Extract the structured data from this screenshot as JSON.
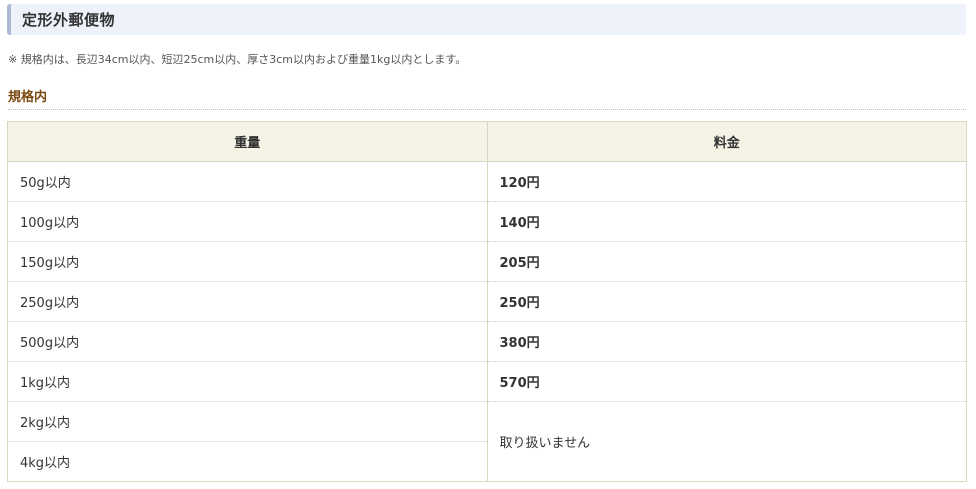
{
  "section": {
    "title": "定形外郵便物"
  },
  "note": "※ 規格内は、長辺34cm以内、短辺25cm以内、厚さ3cm以内および重量1kg以内とします。",
  "subheading": "規格内",
  "table": {
    "headers": [
      "重量",
      "料金"
    ],
    "rows": [
      {
        "weight": "50g以内",
        "price": "120円"
      },
      {
        "weight": "100g以内",
        "price": "140円"
      },
      {
        "weight": "150g以内",
        "price": "205円"
      },
      {
        "weight": "250g以内",
        "price": "250円"
      },
      {
        "weight": "500g以内",
        "price": "380円"
      },
      {
        "weight": "1kg以内",
        "price": "570円"
      },
      {
        "weight": "2kg以内",
        "price": "取り扱いません"
      },
      {
        "weight": "4kg以内",
        "price": ""
      }
    ]
  }
}
